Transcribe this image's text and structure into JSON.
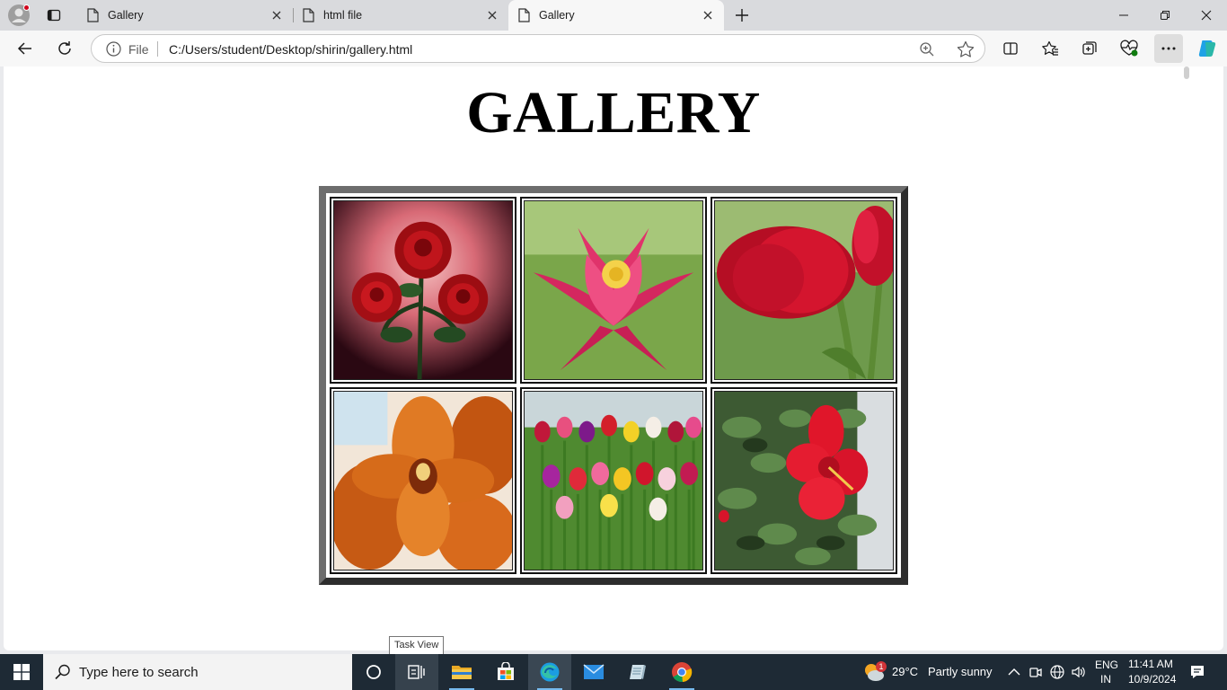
{
  "browser": {
    "tabs": [
      {
        "label": "Gallery",
        "active": false
      },
      {
        "label": "html file",
        "active": false
      },
      {
        "label": "Gallery",
        "active": true
      }
    ],
    "address": {
      "scheme_label": "File",
      "url": "C:/Users/student/Desktop/shirin/gallery.html"
    }
  },
  "page": {
    "heading": "GALLERY",
    "images": [
      {
        "name": "red-roses"
      },
      {
        "name": "pink-lotus"
      },
      {
        "name": "red-tulips"
      },
      {
        "name": "orange-orchids"
      },
      {
        "name": "tulip-field"
      },
      {
        "name": "red-hibiscus"
      }
    ]
  },
  "tooltip": {
    "text": "Task View"
  },
  "taskbar": {
    "search_placeholder": "Type here to search",
    "weather": {
      "temperature": "29°C",
      "condition": "Partly sunny",
      "badge": "1"
    },
    "language": {
      "line1": "ENG",
      "line2": "IN"
    },
    "clock": {
      "time": "11:41 AM",
      "date": "10/9/2024"
    }
  },
  "colors": {
    "taskbar": "#1e2a35",
    "accent": "#0078d4",
    "gallery_frame_light": "#6d6d6d",
    "gallery_frame_dark": "#2d2d2d"
  }
}
